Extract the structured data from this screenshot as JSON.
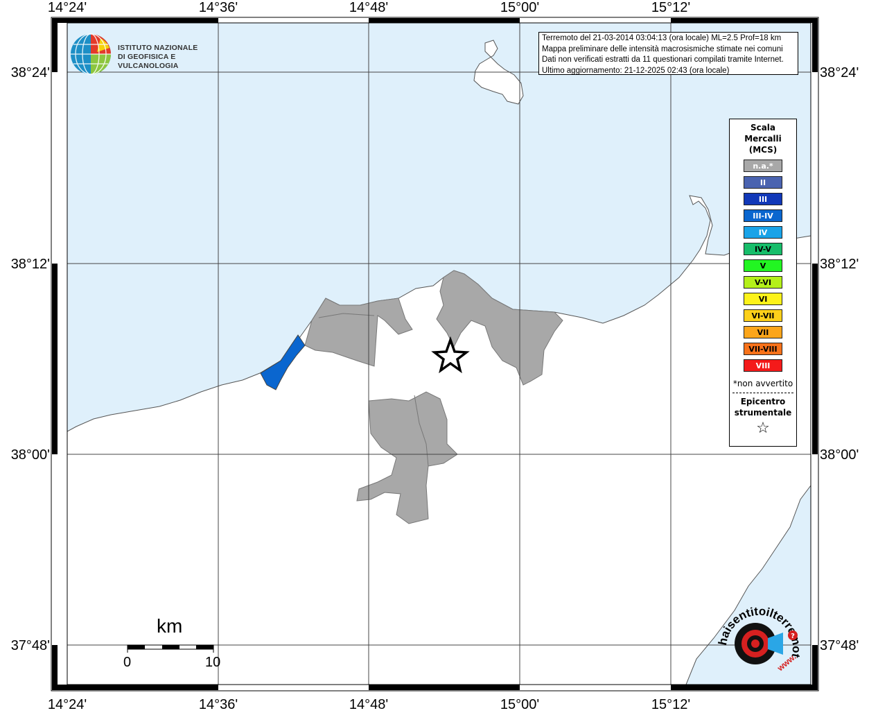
{
  "map": {
    "lon_labels": [
      "14°24'",
      "14°36'",
      "14°48'",
      "15°00'",
      "15°12'"
    ],
    "lat_labels": [
      "38°24'",
      "38°12'",
      "38°00'",
      "37°48'"
    ],
    "colors": {
      "sea": "#dff0fb",
      "land": "#ffffff",
      "not_felt": "#a8a8a8",
      "intensity_III_IV": "#0a66cf"
    }
  },
  "info_box": {
    "line1": "Terremoto del 21-03-2014 03:04:13 (ora locale) ML=2.5 Prof=18 km",
    "line2": "Mappa preliminare delle intensità macrosismiche stimate nei comuni",
    "line3": "Dati non verificati estratti da 11 questionari compilati tramite Internet.",
    "line4": "Ultimo aggiornamento: 21-12-2025 02:43 (ora locale)"
  },
  "logo": {
    "line1": "ISTITUTO NAZIONALE",
    "line2": "DI GEOFISICA E VULCANOLOGIA"
  },
  "legend": {
    "title_line1": "Scala",
    "title_line2": "Mercalli",
    "title_line3": "(MCS)",
    "classes": [
      {
        "label": "n.a.*",
        "color": "#a8a8a8",
        "text_color": "#ffffff"
      },
      {
        "label": "II",
        "color": "#4a63b0",
        "text_color": "#ffffff"
      },
      {
        "label": "III",
        "color": "#1138b8",
        "text_color": "#ffffff"
      },
      {
        "label": "III-IV",
        "color": "#0a66cf",
        "text_color": "#ffffff"
      },
      {
        "label": "IV",
        "color": "#19a3e8",
        "text_color": "#ffffff"
      },
      {
        "label": "IV-V",
        "color": "#17bd6a",
        "text_color": "#000000"
      },
      {
        "label": "V",
        "color": "#22f522",
        "text_color": "#000000"
      },
      {
        "label": "V-VI",
        "color": "#b4f01a",
        "text_color": "#000000"
      },
      {
        "label": "VI",
        "color": "#fdf21a",
        "text_color": "#000000"
      },
      {
        "label": "VI-VII",
        "color": "#fdd01a",
        "text_color": "#000000"
      },
      {
        "label": "VII",
        "color": "#fca51a",
        "text_color": "#000000"
      },
      {
        "label": "VII-VIII",
        "color": "#f8721a",
        "text_color": "#000000"
      },
      {
        "label": "VIII",
        "color": "#f41a1a",
        "text_color": "#ffffff"
      }
    ],
    "not_felt_note": "*non avvertito",
    "epicenter_line1": "Epicentro",
    "epicenter_line2": "strumentale",
    "epicenter_symbol": "☆"
  },
  "scale_bar": {
    "unit": "km",
    "start_label": "0",
    "end_label": "10"
  },
  "watermark": {
    "text": "haisentitoilterremoto.it",
    "url_prefix": "www."
  }
}
